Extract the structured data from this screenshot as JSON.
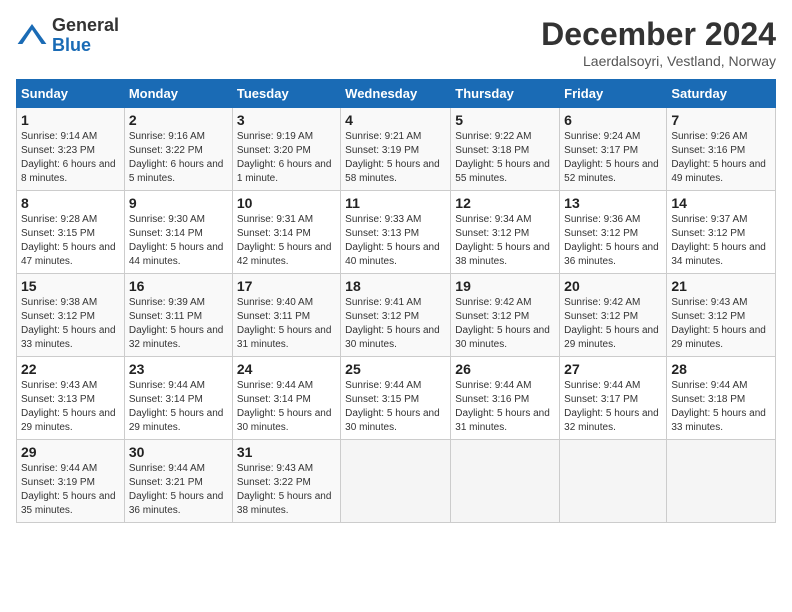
{
  "header": {
    "logo_general": "General",
    "logo_blue": "Blue",
    "month_title": "December 2024",
    "location": "Laerdalsoyri, Vestland, Norway"
  },
  "weekdays": [
    "Sunday",
    "Monday",
    "Tuesday",
    "Wednesday",
    "Thursday",
    "Friday",
    "Saturday"
  ],
  "weeks": [
    [
      {
        "day": "1",
        "sunrise": "9:14 AM",
        "sunset": "3:23 PM",
        "daylight": "6 hours and 8 minutes."
      },
      {
        "day": "2",
        "sunrise": "9:16 AM",
        "sunset": "3:22 PM",
        "daylight": "6 hours and 5 minutes."
      },
      {
        "day": "3",
        "sunrise": "9:19 AM",
        "sunset": "3:20 PM",
        "daylight": "6 hours and 1 minute."
      },
      {
        "day": "4",
        "sunrise": "9:21 AM",
        "sunset": "3:19 PM",
        "daylight": "5 hours and 58 minutes."
      },
      {
        "day": "5",
        "sunrise": "9:22 AM",
        "sunset": "3:18 PM",
        "daylight": "5 hours and 55 minutes."
      },
      {
        "day": "6",
        "sunrise": "9:24 AM",
        "sunset": "3:17 PM",
        "daylight": "5 hours and 52 minutes."
      },
      {
        "day": "7",
        "sunrise": "9:26 AM",
        "sunset": "3:16 PM",
        "daylight": "5 hours and 49 minutes."
      }
    ],
    [
      {
        "day": "8",
        "sunrise": "9:28 AM",
        "sunset": "3:15 PM",
        "daylight": "5 hours and 47 minutes."
      },
      {
        "day": "9",
        "sunrise": "9:30 AM",
        "sunset": "3:14 PM",
        "daylight": "5 hours and 44 minutes."
      },
      {
        "day": "10",
        "sunrise": "9:31 AM",
        "sunset": "3:14 PM",
        "daylight": "5 hours and 42 minutes."
      },
      {
        "day": "11",
        "sunrise": "9:33 AM",
        "sunset": "3:13 PM",
        "daylight": "5 hours and 40 minutes."
      },
      {
        "day": "12",
        "sunrise": "9:34 AM",
        "sunset": "3:12 PM",
        "daylight": "5 hours and 38 minutes."
      },
      {
        "day": "13",
        "sunrise": "9:36 AM",
        "sunset": "3:12 PM",
        "daylight": "5 hours and 36 minutes."
      },
      {
        "day": "14",
        "sunrise": "9:37 AM",
        "sunset": "3:12 PM",
        "daylight": "5 hours and 34 minutes."
      }
    ],
    [
      {
        "day": "15",
        "sunrise": "9:38 AM",
        "sunset": "3:12 PM",
        "daylight": "5 hours and 33 minutes."
      },
      {
        "day": "16",
        "sunrise": "9:39 AM",
        "sunset": "3:11 PM",
        "daylight": "5 hours and 32 minutes."
      },
      {
        "day": "17",
        "sunrise": "9:40 AM",
        "sunset": "3:11 PM",
        "daylight": "5 hours and 31 minutes."
      },
      {
        "day": "18",
        "sunrise": "9:41 AM",
        "sunset": "3:12 PM",
        "daylight": "5 hours and 30 minutes."
      },
      {
        "day": "19",
        "sunrise": "9:42 AM",
        "sunset": "3:12 PM",
        "daylight": "5 hours and 30 minutes."
      },
      {
        "day": "20",
        "sunrise": "9:42 AM",
        "sunset": "3:12 PM",
        "daylight": "5 hours and 29 minutes."
      },
      {
        "day": "21",
        "sunrise": "9:43 AM",
        "sunset": "3:12 PM",
        "daylight": "5 hours and 29 minutes."
      }
    ],
    [
      {
        "day": "22",
        "sunrise": "9:43 AM",
        "sunset": "3:13 PM",
        "daylight": "5 hours and 29 minutes."
      },
      {
        "day": "23",
        "sunrise": "9:44 AM",
        "sunset": "3:14 PM",
        "daylight": "5 hours and 29 minutes."
      },
      {
        "day": "24",
        "sunrise": "9:44 AM",
        "sunset": "3:14 PM",
        "daylight": "5 hours and 30 minutes."
      },
      {
        "day": "25",
        "sunrise": "9:44 AM",
        "sunset": "3:15 PM",
        "daylight": "5 hours and 30 minutes."
      },
      {
        "day": "26",
        "sunrise": "9:44 AM",
        "sunset": "3:16 PM",
        "daylight": "5 hours and 31 minutes."
      },
      {
        "day": "27",
        "sunrise": "9:44 AM",
        "sunset": "3:17 PM",
        "daylight": "5 hours and 32 minutes."
      },
      {
        "day": "28",
        "sunrise": "9:44 AM",
        "sunset": "3:18 PM",
        "daylight": "5 hours and 33 minutes."
      }
    ],
    [
      {
        "day": "29",
        "sunrise": "9:44 AM",
        "sunset": "3:19 PM",
        "daylight": "5 hours and 35 minutes."
      },
      {
        "day": "30",
        "sunrise": "9:44 AM",
        "sunset": "3:21 PM",
        "daylight": "5 hours and 36 minutes."
      },
      {
        "day": "31",
        "sunrise": "9:43 AM",
        "sunset": "3:22 PM",
        "daylight": "5 hours and 38 minutes."
      },
      null,
      null,
      null,
      null
    ]
  ]
}
